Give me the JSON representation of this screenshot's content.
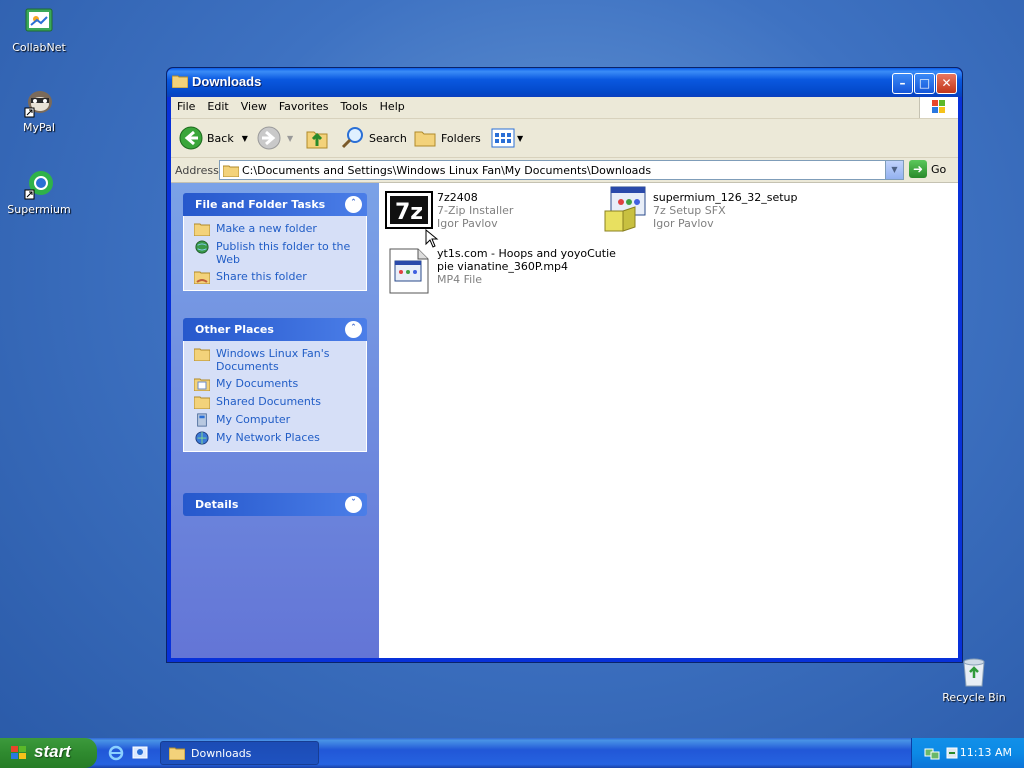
{
  "desktop": {
    "icons": [
      {
        "label": "CollabNet",
        "icon": "collabnet-icon"
      },
      {
        "label": "MyPal",
        "icon": "mypal-icon"
      },
      {
        "label": "Supermium",
        "icon": "supermium-icon"
      },
      {
        "label": "Recycle Bin",
        "icon": "recycle-bin-icon"
      }
    ]
  },
  "window": {
    "title": "Downloads",
    "menu": [
      "File",
      "Edit",
      "View",
      "Favorites",
      "Tools",
      "Help"
    ],
    "toolbar": {
      "back_label": "Back",
      "search_label": "Search",
      "folders_label": "Folders"
    },
    "address": {
      "label": "Address",
      "value": "C:\\Documents and Settings\\Windows Linux Fan\\My Documents\\Downloads",
      "go_label": "Go"
    },
    "file_tasks": {
      "title": "File and Folder Tasks",
      "items": [
        "Make a new folder",
        "Publish this folder to the Web",
        "Share this folder"
      ]
    },
    "other_places": {
      "title": "Other Places",
      "items": [
        "Windows Linux Fan's Documents",
        "My Documents",
        "Shared Documents",
        "My Computer",
        "My Network Places"
      ]
    },
    "details": {
      "title": "Details"
    },
    "files": [
      {
        "name": "7z2408",
        "type": "7-Zip Installer",
        "company": "Igor Pavlov",
        "icon_text": "7z"
      },
      {
        "name": "supermium_126_32_setup",
        "type": "7z Setup SFX",
        "company": "Igor Pavlov"
      },
      {
        "name_line1": "yt1s.com - Hoops and yoyoCutie",
        "name_line2": "pie vianatine_360P.mp4",
        "type": "MP4 File"
      }
    ]
  },
  "taskbar": {
    "start_label": "start",
    "task_label": "Downloads",
    "clock": "11:13 AM"
  },
  "colors": {
    "link": "#215dc6",
    "title_blue": "#0a58e0",
    "start_green": "#2f8a2f"
  }
}
